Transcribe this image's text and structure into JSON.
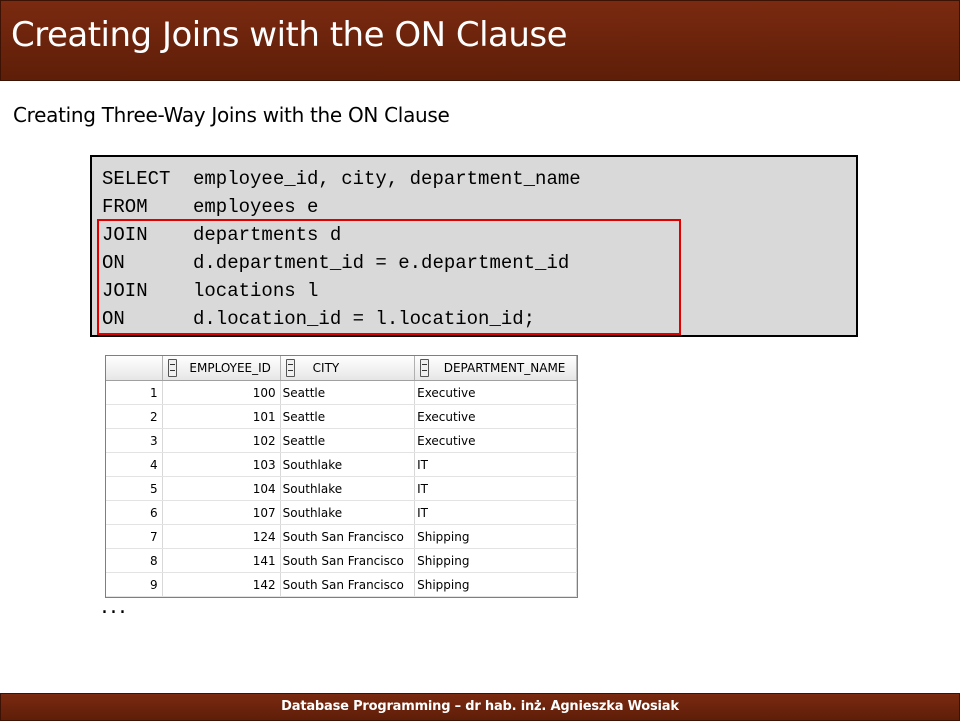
{
  "title": "Creating Joins with the ON Clause",
  "subtitle": "Creating Three-Way Joins with the ON Clause",
  "code": [
    {
      "kw": "SELECT",
      "rest": "employee_id, city, department_name"
    },
    {
      "kw": "FROM",
      "rest": "employees e"
    },
    {
      "kw": "JOIN",
      "rest": "departments d"
    },
    {
      "kw": "ON",
      "rest": "d.department_id = e.department_id"
    },
    {
      "kw": "JOIN",
      "rest": "locations l"
    },
    {
      "kw": "ON",
      "rest": "d.location_id = l.location_id;"
    }
  ],
  "colors": {
    "title_bar": "#6b2410",
    "highlight": "#e00000",
    "code_bg": "#d9d9d9"
  },
  "grid": {
    "columns": [
      "EMPLOYEE_ID",
      "CITY",
      "DEPARTMENT_NAME"
    ],
    "rows": [
      {
        "n": "1",
        "employee_id": "100",
        "city": "Seattle",
        "department_name": "Executive"
      },
      {
        "n": "2",
        "employee_id": "101",
        "city": "Seattle",
        "department_name": "Executive"
      },
      {
        "n": "3",
        "employee_id": "102",
        "city": "Seattle",
        "department_name": "Executive"
      },
      {
        "n": "4",
        "employee_id": "103",
        "city": "Southlake",
        "department_name": "IT"
      },
      {
        "n": "5",
        "employee_id": "104",
        "city": "Southlake",
        "department_name": "IT"
      },
      {
        "n": "6",
        "employee_id": "107",
        "city": "Southlake",
        "department_name": "IT"
      },
      {
        "n": "7",
        "employee_id": "124",
        "city": "South San Francisco",
        "department_name": "Shipping"
      },
      {
        "n": "8",
        "employee_id": "141",
        "city": "South San Francisco",
        "department_name": "Shipping"
      },
      {
        "n": "9",
        "employee_id": "142",
        "city": "South San Francisco",
        "department_name": "Shipping"
      }
    ]
  },
  "ellipsis": "...",
  "footer": "Database Programming – dr hab. inż. Agnieszka Wosiak"
}
